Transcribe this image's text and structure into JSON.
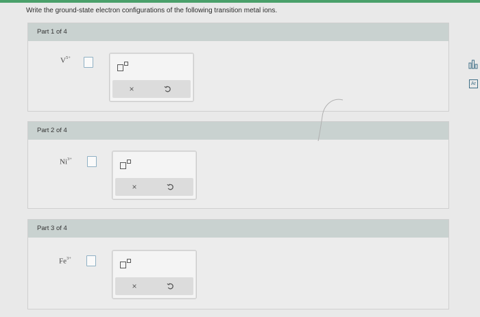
{
  "instruction": "Write the ground-state electron configurations of the following transition metal ions.",
  "parts": [
    {
      "header": "Part 1 of 4",
      "ion_symbol": "V",
      "ion_charge": "5+"
    },
    {
      "header": "Part 2 of 4",
      "ion_symbol": "Ni",
      "ion_charge": "3+"
    },
    {
      "header": "Part 3 of 4",
      "ion_symbol": "Fe",
      "ion_charge": "3+"
    }
  ],
  "toolbox": {
    "superscript_icon": "superscript-template-icon",
    "clear_symbol": "×",
    "undo_icon": "undo-icon"
  },
  "side_tools": {
    "data_icon": "data-bars-icon",
    "periodic_table_label": "Ar"
  },
  "colors": {
    "top_bar": "#4aa06a",
    "header_bg": "#c9d2d0",
    "answer_border": "#8fb0c4"
  }
}
